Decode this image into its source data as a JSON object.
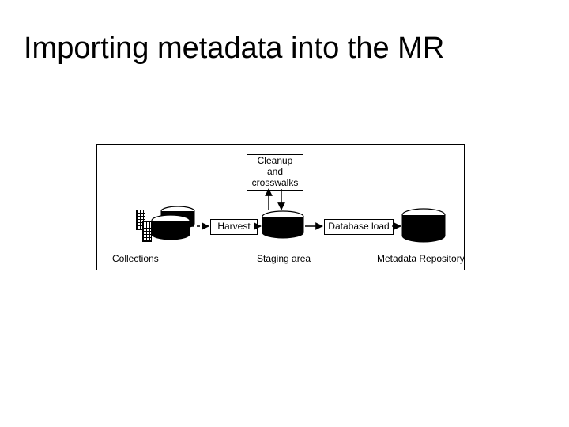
{
  "title": "Importing metadata into the MR",
  "boxes": {
    "cleanup": "Cleanup\nand\ncrosswalks",
    "harvest": "Harvest",
    "dbload": "Database load"
  },
  "captions": {
    "collections": "Collections",
    "staging": "Staging area",
    "mr": "Metadata Repository"
  }
}
